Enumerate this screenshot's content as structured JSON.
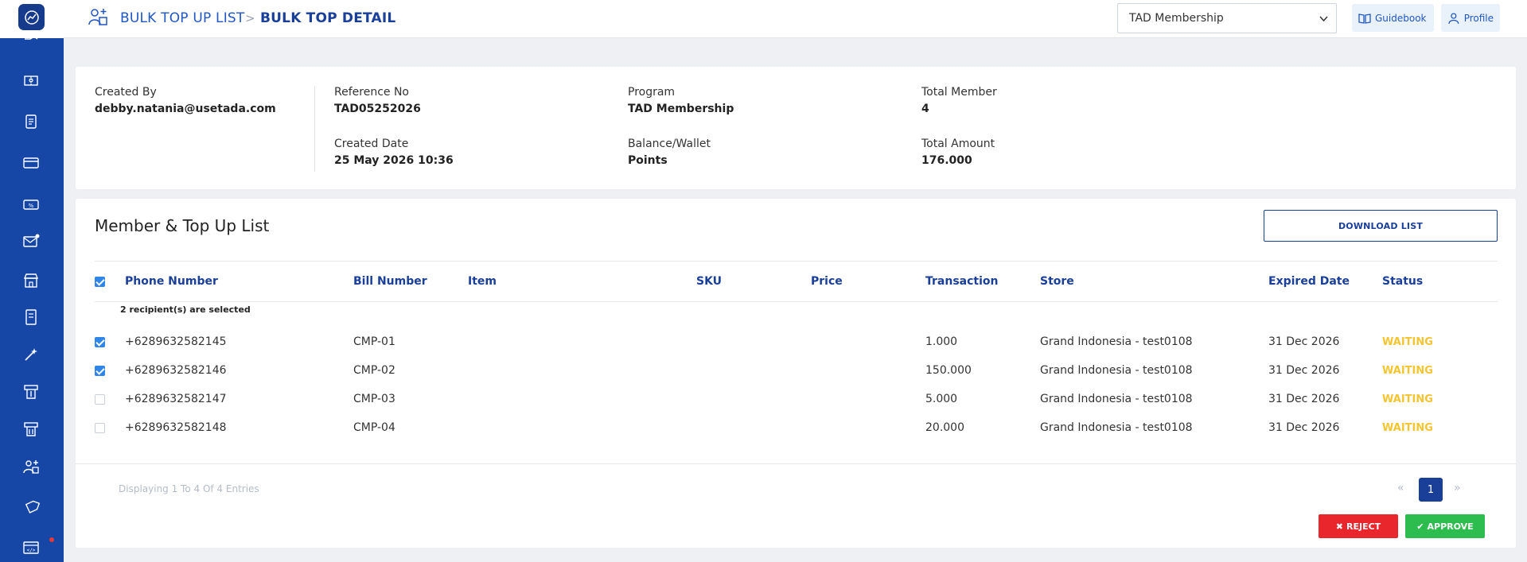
{
  "header": {
    "breadcrumb_list": "BULK TOP UP LIST",
    "breadcrumb_sep": ">",
    "breadcrumb_current": "BULK TOP DETAIL",
    "program_select": "TAD Membership",
    "guidebook_label": "Guidebook",
    "profile_label": "Profile"
  },
  "info": {
    "created_by_label": "Created By",
    "created_by_value": "debby.natania@usetada.com",
    "reference_label": "Reference No",
    "reference_value": "TAD05252026",
    "created_date_label": "Created Date",
    "created_date_value": "25 May 2026 10:36",
    "program_label": "Program",
    "program_value": "TAD Membership",
    "balance_label": "Balance/Wallet",
    "balance_value": "Points",
    "total_member_label": "Total Member",
    "total_member_value": "4",
    "total_amount_label": "Total Amount",
    "total_amount_value": "176.000"
  },
  "list": {
    "title": "Member & Top Up List",
    "download_label": "DOWNLOAD LIST",
    "columns": {
      "phone": "Phone Number",
      "bill": "Bill Number",
      "item": "Item",
      "sku": "SKU",
      "price": "Price",
      "transaction": "Transaction",
      "store": "Store",
      "expired": "Expired Date",
      "status": "Status"
    },
    "selected_note": "2 recipient(s) are selected",
    "rows": [
      {
        "checked": true,
        "phone": "+6289632582145",
        "bill": "CMP-01",
        "transaction": "1.000",
        "store": "Grand Indonesia - test0108",
        "expired": "31 Dec 2026",
        "status": "WAITING"
      },
      {
        "checked": true,
        "phone": "+6289632582146",
        "bill": "CMP-02",
        "transaction": "150.000",
        "store": "Grand Indonesia - test0108",
        "expired": "31 Dec 2026",
        "status": "WAITING"
      },
      {
        "checked": false,
        "phone": "+6289632582147",
        "bill": "CMP-03",
        "transaction": "5.000",
        "store": "Grand Indonesia - test0108",
        "expired": "31 Dec 2026",
        "status": "WAITING"
      },
      {
        "checked": false,
        "phone": "+6289632582148",
        "bill": "CMP-04",
        "transaction": "20.000",
        "store": "Grand Indonesia - test0108",
        "expired": "31 Dec 2026",
        "status": "WAITING"
      }
    ],
    "footer_text": "Displaying 1 To 4 Of 4 Entries",
    "pager_prev": "«",
    "pager_current": "1",
    "pager_next": "»",
    "reject_label": "REJECT",
    "approve_label": "APPROVE"
  },
  "colors": {
    "sidebar": "#1747a6",
    "accent": "#1a3f99",
    "waiting": "#f5c531",
    "reject": "#e8262b",
    "approve": "#2dbd4f"
  },
  "icons": {
    "sidebar": [
      "hand-icon",
      "ticket-icon",
      "document-icon",
      "card-icon",
      "voucher-icon",
      "mail-icon",
      "store-icon",
      "receipt-icon",
      "magic-wand-icon",
      "topup-icon",
      "topup-alt-icon",
      "bulk-user-icon",
      "tag-icon",
      "code-window-icon"
    ]
  }
}
